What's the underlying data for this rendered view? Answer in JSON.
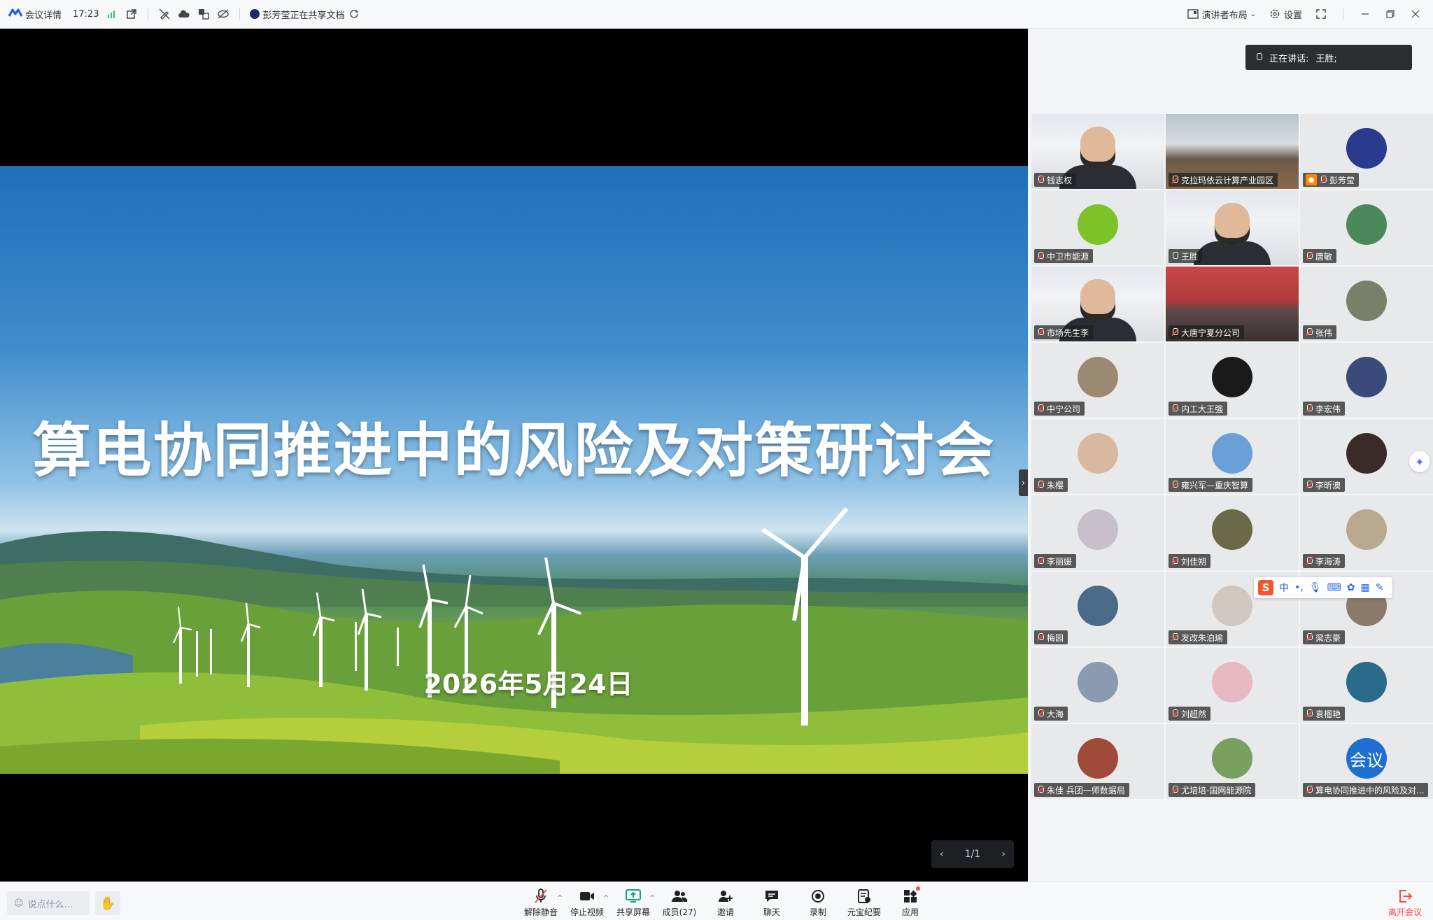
{
  "topbar": {
    "meeting_details": "会议详情",
    "time": "17:23",
    "sharing_status": "彭芳莹正在共享文档",
    "layout_label": "演讲者布局",
    "settings_label": "设置"
  },
  "slide": {
    "title": "算电协同推进中的风险及对策研讨会",
    "date": "2026年5月24日",
    "page": "1/1"
  },
  "speaking": {
    "label": "正在讲话:",
    "name": "王胜;"
  },
  "participants": [
    {
      "name": "钱志权",
      "style": "video-man"
    },
    {
      "name": "克拉玛依云计算产业园区",
      "style": "video-room"
    },
    {
      "name": "彭芳莹",
      "style": "avatar",
      "color": "#2a3a8c",
      "host": true
    },
    {
      "name": "中卫市能源",
      "style": "avatar",
      "color": "#7cc32a"
    },
    {
      "name": "王胜",
      "style": "video-man2",
      "active": true
    },
    {
      "name": "唐敏",
      "style": "avatar",
      "color": "#4a8a5a"
    },
    {
      "name": "市场先生李",
      "style": "video-man3"
    },
    {
      "name": "大唐宁夏分公司",
      "style": "video-room2"
    },
    {
      "name": "张伟",
      "style": "avatar",
      "color": "#7a7f6a"
    },
    {
      "name": "中宁公司",
      "style": "avatar",
      "color": "#9a8a72"
    },
    {
      "name": "内工大王强",
      "style": "avatar",
      "color": "#1a1a1a"
    },
    {
      "name": "李宏伟",
      "style": "avatar",
      "color": "#3a4a7a"
    },
    {
      "name": "朱樱",
      "style": "avatar",
      "color": "#d8b8a0"
    },
    {
      "name": "雍兴军—重庆智算",
      "style": "avatar",
      "color": "#6aa0d8"
    },
    {
      "name": "李昕澳",
      "style": "avatar",
      "color": "#3a2a2a"
    },
    {
      "name": "李丽媛",
      "style": "avatar",
      "color": "#c8c0c8"
    },
    {
      "name": "刘佳朔",
      "style": "avatar",
      "color": "#6a6a4a"
    },
    {
      "name": "李海涛",
      "style": "avatar",
      "color": "#b8a890"
    },
    {
      "name": "梅园",
      "style": "avatar",
      "color": "#4a6a8a"
    },
    {
      "name": "发改朱泊瑜",
      "style": "avatar",
      "color": "#d0c8c0"
    },
    {
      "name": "梁志豪",
      "style": "avatar",
      "color": "#8a7a6a"
    },
    {
      "name": "大海",
      "style": "avatar",
      "color": "#8a9ab0"
    },
    {
      "name": "刘超然",
      "style": "avatar",
      "color": "#e8b8c0"
    },
    {
      "name": "袁榴艳",
      "style": "avatar",
      "color": "#2a6a8a"
    },
    {
      "name": "朱佳 兵团一师数据局",
      "style": "avatar",
      "color": "#a04a3a"
    },
    {
      "name": "尤培培-国网能源院",
      "style": "avatar",
      "color": "#7aa060"
    },
    {
      "name": "算电协同推进中的风险及对...",
      "style": "avatar-text",
      "color": "#1f6fd1",
      "text": "会议"
    }
  ],
  "ime": {
    "zh": "中"
  },
  "bottom": {
    "say_placeholder": "说点什么...",
    "unmute": "解除静音",
    "stop_video": "停止视频",
    "share_screen": "共享屏幕",
    "members": "成员(27)",
    "invite": "邀请",
    "chat": "聊天",
    "record": "录制",
    "ai_minutes": "元宝纪要",
    "apps": "应用",
    "leave": "离开会议"
  }
}
